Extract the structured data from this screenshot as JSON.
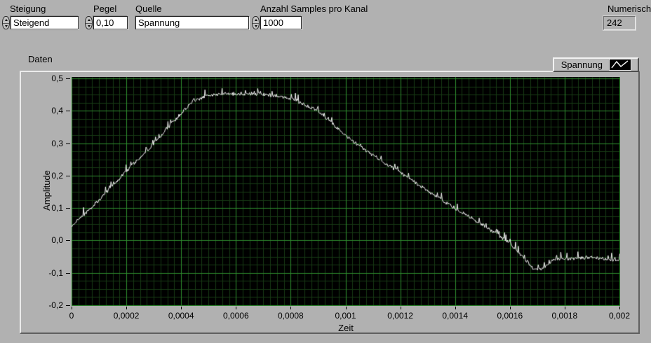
{
  "colors": {
    "window_bg": "#b1b1b1",
    "plot_bg": "#000000",
    "grid_major": "#2e8c2e",
    "grid_minor": "#173a14",
    "trace": "#f7f7f7",
    "text": "#000000"
  },
  "icons": {
    "spinner_up": "increment triangle ▲",
    "spinner_down": "decrement triangle ▼",
    "legend_waveform": "white zigzag line on black"
  },
  "controls": {
    "steigung": {
      "label": "Steigung",
      "value": "Steigend"
    },
    "pegel": {
      "label": "Pegel",
      "value": "0,10"
    },
    "quelle": {
      "label": "Quelle",
      "value": "Spannung"
    },
    "anzahl_samples": {
      "label": "Anzahl Samples pro Kanal",
      "value": "1000"
    },
    "numerisch": {
      "label": "Numerisch",
      "value": "242"
    }
  },
  "graph": {
    "title": "Daten",
    "legend_label": "Spannung"
  },
  "chart_data": {
    "type": "line",
    "title": "Daten",
    "xlabel": "Zeit",
    "ylabel": "Amplitude",
    "xlim": [
      0,
      0.002
    ],
    "ylim": [
      -0.2,
      0.5
    ],
    "grid": {
      "on": true,
      "x_minor_per_major": 8,
      "y_minor_per_major": 4
    },
    "legend_position": "top-right",
    "x_ticks": [
      {
        "v": 0,
        "label": "0"
      },
      {
        "v": 0.0002,
        "label": "0,0002"
      },
      {
        "v": 0.0004,
        "label": "0,0004"
      },
      {
        "v": 0.0006,
        "label": "0,0006"
      },
      {
        "v": 0.0008,
        "label": "0,0008"
      },
      {
        "v": 0.001,
        "label": "0,001"
      },
      {
        "v": 0.0012,
        "label": "0,0012"
      },
      {
        "v": 0.0014,
        "label": "0,0014"
      },
      {
        "v": 0.0016,
        "label": "0,0016"
      },
      {
        "v": 0.0018,
        "label": "0,0018"
      },
      {
        "v": 0.002,
        "label": "0,002"
      }
    ],
    "y_ticks": [
      {
        "v": 0.5,
        "label": "0,5"
      },
      {
        "v": 0.4,
        "label": "0,4"
      },
      {
        "v": 0.3,
        "label": "0,3"
      },
      {
        "v": 0.2,
        "label": "0,2"
      },
      {
        "v": 0.1,
        "label": "0,1"
      },
      {
        "v": 0.0,
        "label": "0,0"
      },
      {
        "v": -0.1,
        "label": "-0,1"
      },
      {
        "v": -0.2,
        "label": "-0,2"
      }
    ],
    "series": [
      {
        "name": "Spannung",
        "color": "#f7f7f7",
        "samples": 800,
        "noise_amplitude": 0.005,
        "spike_amplitude": 0.02,
        "spike_probability": 0.12,
        "envelope_points": [
          [
            0,
            0.045
          ],
          [
            0.0001,
            0.125
          ],
          [
            0.0002,
            0.215
          ],
          [
            0.0003,
            0.3
          ],
          [
            0.00038,
            0.375
          ],
          [
            0.00044,
            0.43
          ],
          [
            0.0005,
            0.447
          ],
          [
            0.00056,
            0.452
          ],
          [
            0.0007,
            0.451
          ],
          [
            0.0008,
            0.437
          ],
          [
            0.0009,
            0.4
          ],
          [
            0.001,
            0.322
          ],
          [
            0.0011,
            0.262
          ],
          [
            0.0012,
            0.208
          ],
          [
            0.0013,
            0.152
          ],
          [
            0.0014,
            0.098
          ],
          [
            0.0015,
            0.048
          ],
          [
            0.0016,
            -0.01
          ],
          [
            0.00165,
            -0.055
          ],
          [
            0.00169,
            -0.092
          ],
          [
            0.00172,
            -0.085
          ],
          [
            0.00176,
            -0.058
          ],
          [
            0.0019,
            -0.053
          ],
          [
            0.002,
            -0.062
          ]
        ]
      }
    ]
  }
}
